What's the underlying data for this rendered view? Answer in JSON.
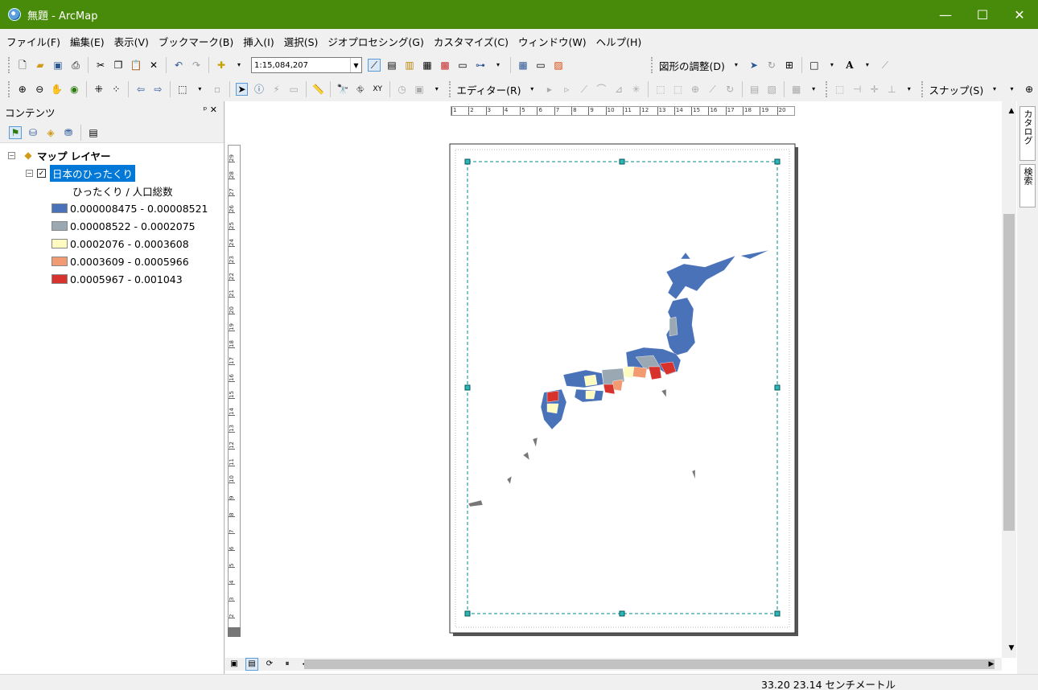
{
  "window": {
    "title": "無題 - ArcMap",
    "minimize": "—",
    "maximize": "☐",
    "close": "✕"
  },
  "menu": [
    "ファイル(F)",
    "編集(E)",
    "表示(V)",
    "ブックマーク(B)",
    "挿入(I)",
    "選択(S)",
    "ジオプロセシング(G)",
    "カスタマイズ(C)",
    "ウィンドウ(W)",
    "ヘルプ(H)"
  ],
  "toolbar1": {
    "scale": "1:15,084,207",
    "drawing_label": "図形の調整(D)"
  },
  "toolbar2": {
    "editor_label": "エディター(R)",
    "snap_label": "スナップ(S)"
  },
  "toc": {
    "title": "コンテンツ",
    "pin": "ᵖ ✕",
    "root": "マップ レイヤー",
    "layer": "日本のひったくり",
    "field": "ひったくり / 人口総数",
    "classes": [
      {
        "label": "0.000008475 - 0.00008521",
        "color": "#4a72b8"
      },
      {
        "label": "0.00008522 - 0.0002075",
        "color": "#9aa8b4"
      },
      {
        "label": "0.0002076 - 0.0003608",
        "color": "#fdfbbf"
      },
      {
        "label": "0.0003609 - 0.0005966",
        "color": "#f29a72"
      },
      {
        "label": "0.0005967 - 0.001043",
        "color": "#d7322c"
      }
    ]
  },
  "ruler": {
    "top_ticks": [
      "1",
      "2",
      "3",
      "4",
      "5",
      "6",
      "7",
      "8",
      "9",
      "10",
      "11",
      "12",
      "13",
      "14",
      "15",
      "16",
      "17",
      "18",
      "19",
      "20"
    ],
    "left_ticks": [
      "29",
      "28",
      "27",
      "26",
      "25",
      "24",
      "23",
      "22",
      "21",
      "20",
      "19",
      "18",
      "17",
      "16",
      "15",
      "14",
      "13",
      "12",
      "11",
      "10",
      "9",
      "8",
      "7",
      "6",
      "5",
      "4",
      "3",
      "2",
      "1"
    ]
  },
  "side_tabs": [
    "カタログ",
    "検索"
  ],
  "status": {
    "coords": "33.20  23.14 センチメートル"
  },
  "colors": {
    "titlebar": "#488a09",
    "selection": "#0078d7",
    "frame_border": "#008b8b"
  }
}
